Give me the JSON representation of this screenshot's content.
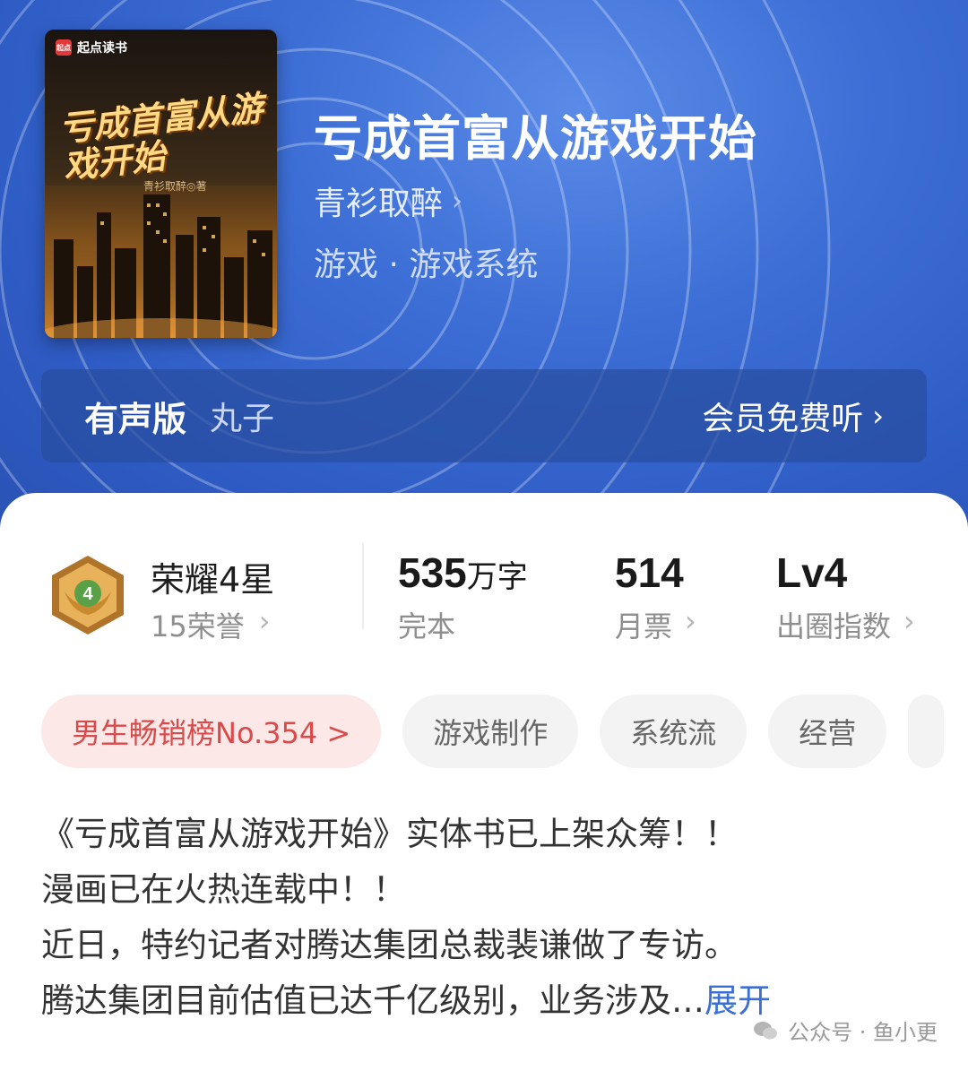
{
  "book": {
    "title": "亏成首富从游戏开始",
    "author": "青衫取醉",
    "genre": "游戏 · 游戏系统",
    "cover": {
      "publisher": "起点读书",
      "publisher_logo": "起点",
      "cover_title": "亏成首富从游戏开始",
      "cover_author": "青衫取醉◎著"
    }
  },
  "audio": {
    "label": "有声版",
    "narrator": "丸子",
    "action": "会员免费听"
  },
  "stats": {
    "honor": {
      "title": "荣耀4星",
      "sub": "15荣誉",
      "medal_level": "4"
    },
    "words": {
      "num": "535",
      "unit": "万字",
      "label": "完本"
    },
    "votes": {
      "num": "514",
      "label": "月票"
    },
    "index": {
      "num": "Lv4",
      "label": "出圈指数"
    }
  },
  "tags": {
    "rank": "男生畅销榜No.354 >",
    "t1": "游戏制作",
    "t2": "系统流",
    "t3": "经营"
  },
  "description": {
    "line1": "《亏成首富从游戏开始》实体书已上架众筹！！",
    "line2": "漫画已在火热连载中！！",
    "line3": "近日，特约记者对腾达集团总裁裴谦做了专访。",
    "line4": "腾达集团目前估值已达千亿级别，业务涉及…",
    "expand": "展开"
  },
  "watermark": "公众号 · 鱼小更",
  "colors": {
    "hero_blue": "#3d6fd6",
    "rank_red": "#d94a4a",
    "link_blue": "#3b6fd6"
  }
}
